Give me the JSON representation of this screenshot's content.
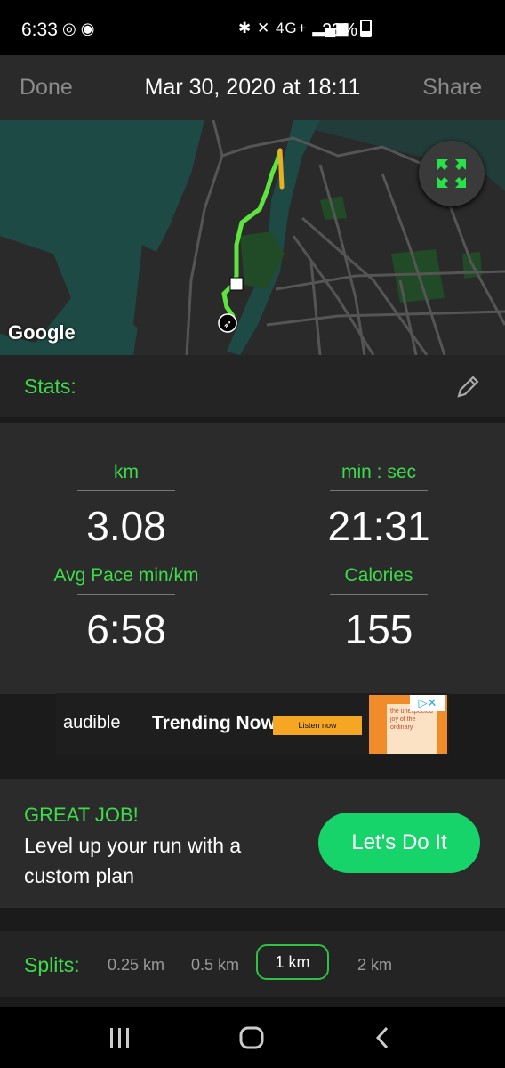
{
  "status_bar": {
    "time": "6:33",
    "icons_left": [
      "whatsapp-icon",
      "spotify-icon"
    ],
    "icons_right": [
      "bluetooth-icon",
      "mute-icon",
      "4g-icon",
      "signal-icon"
    ],
    "network_label": "4G+",
    "battery": "23%"
  },
  "topbar": {
    "done_label": "Done",
    "title": "Mar 30, 2020 at 18:11",
    "share_label": "Share"
  },
  "map": {
    "attribution": "Google",
    "colors": {
      "land": "#2a2a2a",
      "water": "#1e4a46",
      "park": "#214a26",
      "road": "#555555",
      "route": "#5ee43f",
      "route_hot": "#e6b022"
    }
  },
  "stats": {
    "header": "Stats:",
    "items": [
      {
        "label": "km",
        "value": "3.08"
      },
      {
        "label": "min : sec",
        "value": "21:31"
      },
      {
        "label": "Avg Pace min/km",
        "value": "6:58"
      },
      {
        "label": "Calories",
        "value": "155"
      }
    ]
  },
  "ad": {
    "brand": "audible",
    "headline": "Trending Now",
    "cta": "Listen now",
    "book_text": "the unexpected joy of the ordinary"
  },
  "plan": {
    "title": "GREAT JOB!",
    "text": "Level up your run with a custom plan",
    "button": "Let's Do It"
  },
  "splits": {
    "label": "Splits:",
    "options": [
      "0.25 km",
      "0.5 km",
      "1 km",
      "2 km"
    ],
    "selected": "1 km"
  },
  "colors": {
    "accent": "#3ddc4a",
    "button": "#16d46a",
    "background": "#1b1b1b"
  }
}
